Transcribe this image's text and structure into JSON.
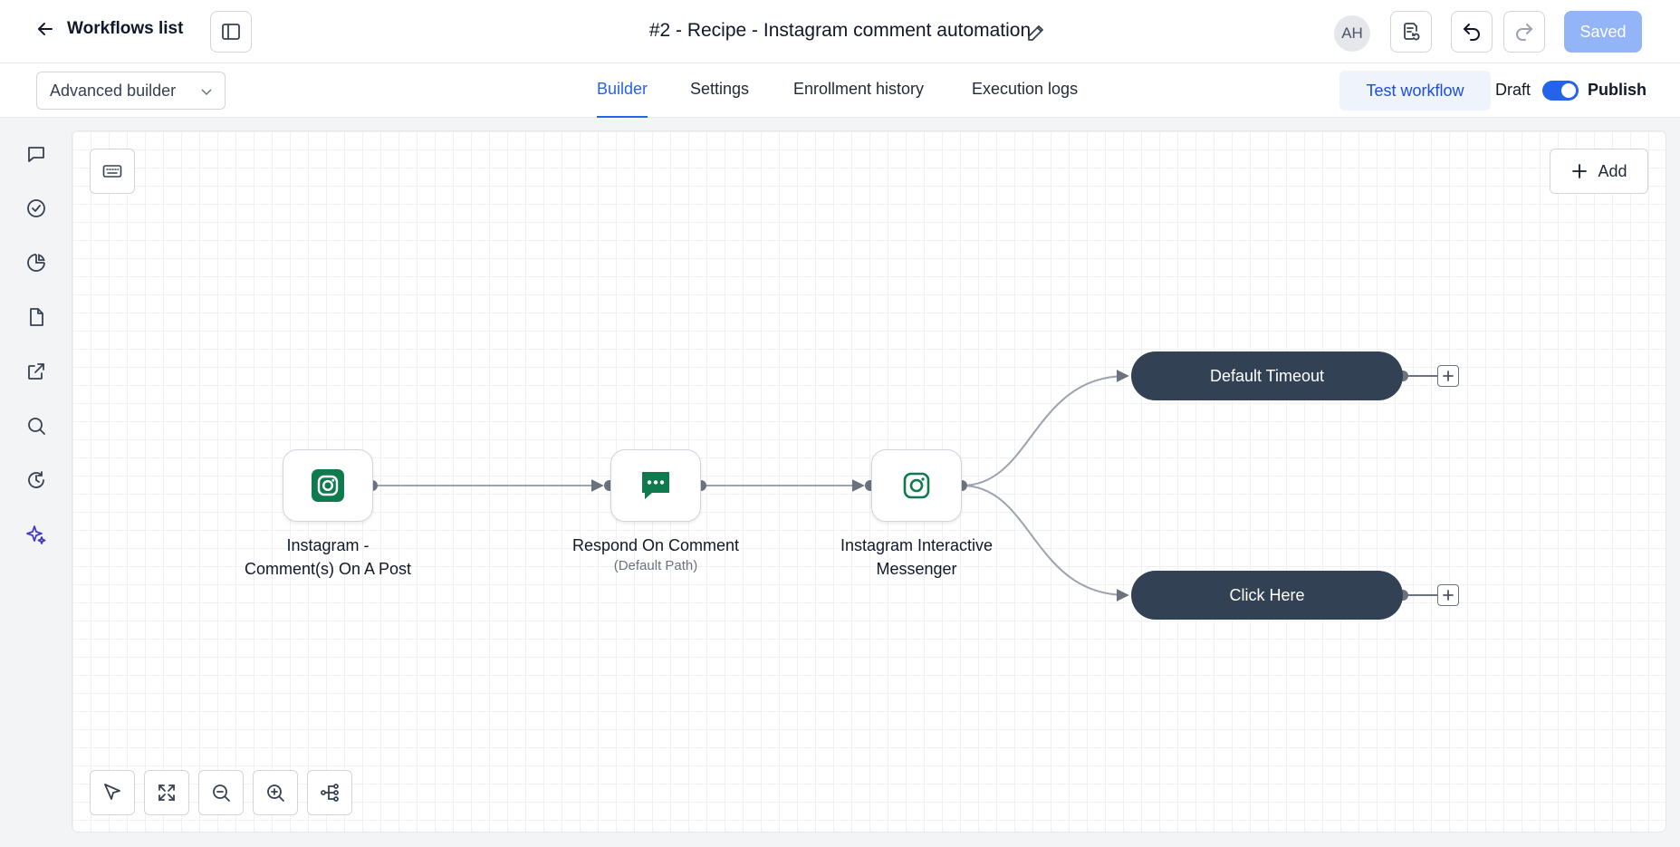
{
  "header": {
    "back_label": "Workflows list",
    "workflow_title": "#2 - Recipe - Instagram comment automation",
    "avatar_initials": "AH",
    "saved_label": "Saved"
  },
  "subbar": {
    "builder_mode": "Advanced builder",
    "tabs": [
      {
        "label": "Builder",
        "active": true
      },
      {
        "label": "Settings",
        "active": false
      },
      {
        "label": "Enrollment history",
        "active": false
      },
      {
        "label": "Execution logs",
        "active": false
      }
    ],
    "test_label": "Test workflow",
    "draft_label": "Draft",
    "publish_label": "Publish",
    "publish_toggle_on": true
  },
  "sidebar": {
    "icons": [
      "chat-icon",
      "check-circle-icon",
      "pie-chart-icon",
      "document-icon",
      "external-link-icon",
      "search-icon",
      "history-icon",
      "sparkle-icon"
    ]
  },
  "canvas": {
    "add_label": "Add",
    "nodes": [
      {
        "label_line1": "Instagram -",
        "label_line2": "Comment(s) On A Post",
        "icon": "instagram-icon"
      },
      {
        "label_line1": "Respond On Comment",
        "sublabel": "(Default Path)",
        "icon": "message-icon"
      },
      {
        "label_line1": "Instagram Interactive",
        "label_line2": "Messenger",
        "icon": "instagram-icon"
      }
    ],
    "branches": [
      {
        "label": "Default Timeout"
      },
      {
        "label": "Click Here"
      }
    ]
  },
  "colors": {
    "accent": "#2563eb",
    "saved_button": "#93b4f6",
    "pill": "#334155",
    "node_icon_green": "#0f7a4d",
    "sparkle": "#4338ca"
  }
}
